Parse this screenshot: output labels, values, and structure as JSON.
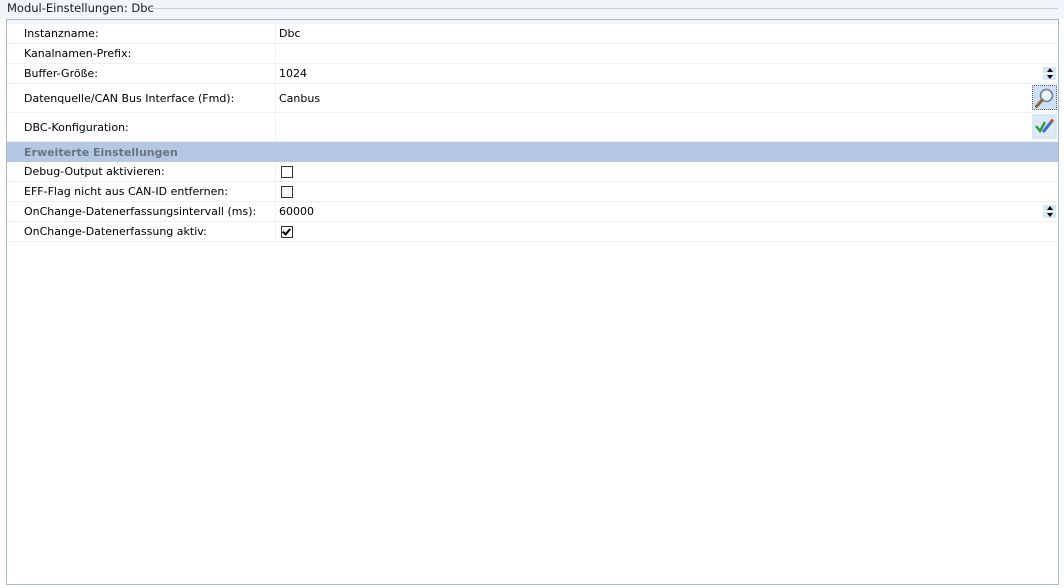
{
  "panel": {
    "title": "Modul-Einstellungen: Dbc"
  },
  "rows": {
    "instanzname": {
      "label": "Instanzname:",
      "value": "Dbc"
    },
    "kanalnamen_prefix": {
      "label": "Kanalnamen-Prefix:",
      "value": ""
    },
    "buffer_groesse": {
      "label": "Buffer-Größe:",
      "value": "1024"
    },
    "datenquelle": {
      "label": "Datenquelle/CAN Bus Interface (Fmd):",
      "value": "Canbus",
      "button_icon": "search-icon"
    },
    "dbc_konfiguration": {
      "label": "DBC-Konfiguration:",
      "value": "",
      "button_icon": "edit-icon"
    }
  },
  "advanced": {
    "section_label": "Erweiterte Einstellungen",
    "debug_output": {
      "label": "Debug-Output aktivieren:",
      "checked": false
    },
    "eff_flag": {
      "label": "EFF-Flag nicht aus CAN-ID entfernen:",
      "checked": false
    },
    "onchange_interval": {
      "label": "OnChange-Datenerfassungsintervall (ms):",
      "value": "60000"
    },
    "onchange_active": {
      "label": "OnChange-Datenerfassung aktiv:",
      "checked": true
    }
  },
  "colors": {
    "section_bg": "#b4c8e3",
    "section_text": "#6a7480",
    "frame_border": "#a9b8cc"
  }
}
